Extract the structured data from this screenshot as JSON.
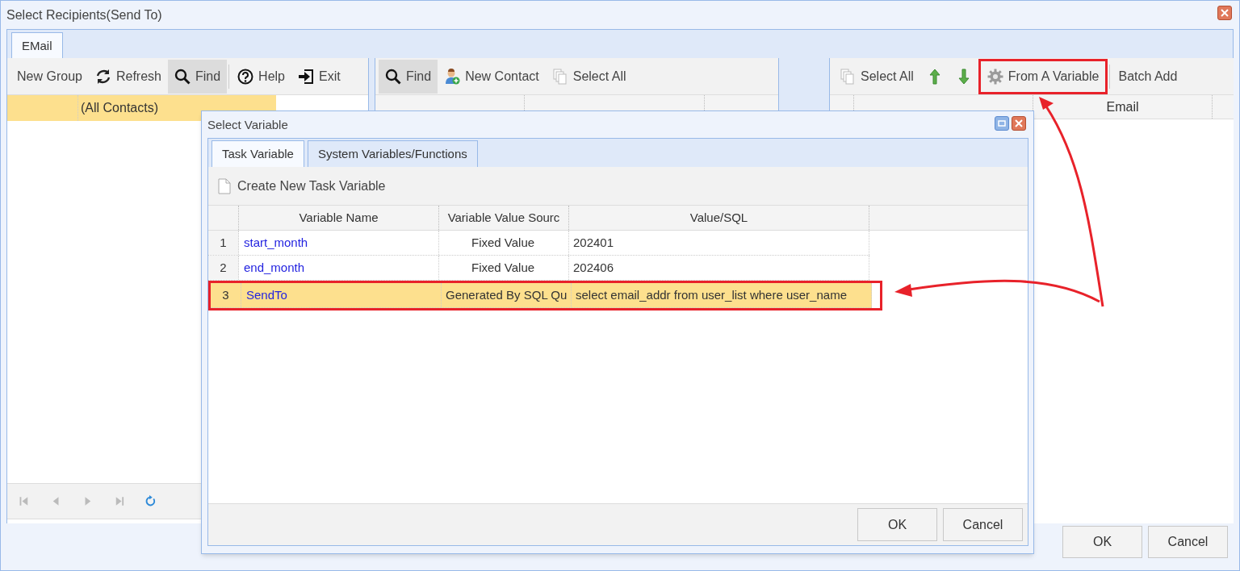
{
  "window": {
    "title": "Select Recipients(Send To)"
  },
  "tabs": [
    {
      "label": "EMail",
      "selected": true
    }
  ],
  "left_panel": {
    "toolbar": [
      {
        "label": "New Group",
        "pressed": false
      },
      {
        "label": "Refresh",
        "pressed": false
      },
      {
        "label": "Find",
        "pressed": true
      },
      {
        "kind": "separator"
      },
      {
        "label": "Help",
        "pressed": false
      },
      {
        "label": "Exit",
        "pressed": false
      }
    ],
    "rows": [
      {
        "label": "(All Contacts)",
        "selected": true
      }
    ]
  },
  "middle_panel": {
    "toolbar": [
      {
        "label": "Find",
        "pressed": true
      },
      {
        "label": "New Contact",
        "pressed": false
      },
      {
        "label": "Select All",
        "pressed": false
      }
    ]
  },
  "right_panel": {
    "toolbar": [
      {
        "label": "Select All",
        "pressed": false
      },
      {
        "pressed": false
      },
      {
        "pressed": false
      },
      {
        "label": "From A Variable",
        "pressed": false
      },
      {
        "kind": "separator"
      },
      {
        "label": "Batch Add",
        "pressed": false
      }
    ],
    "columns": [
      "Email"
    ]
  },
  "buttons": [
    "OK",
    "Cancel"
  ],
  "dialog": {
    "title": "Select Variable",
    "tabs": [
      {
        "label": "Task Variable",
        "selected": true
      },
      {
        "label": "System Variables/Functions",
        "selected": false
      }
    ],
    "toolbar": [
      {
        "label": "Create New Task Variable"
      }
    ],
    "columns": [
      "Variable Name",
      "Variable Value Sourc",
      "Value/SQL"
    ],
    "rows": [
      {
        "index": "1",
        "name": "start_month",
        "source": "Fixed Value",
        "value": "202401",
        "selected": false
      },
      {
        "index": "2",
        "name": "end_month",
        "source": "Fixed Value",
        "value": "202406",
        "selected": false
      },
      {
        "index": "3",
        "name": "SendTo",
        "source": "Generated By SQL Qu",
        "value": "select email_addr from user_list where user_name",
        "selected": true
      }
    ],
    "buttons": [
      "OK",
      "Cancel"
    ]
  }
}
